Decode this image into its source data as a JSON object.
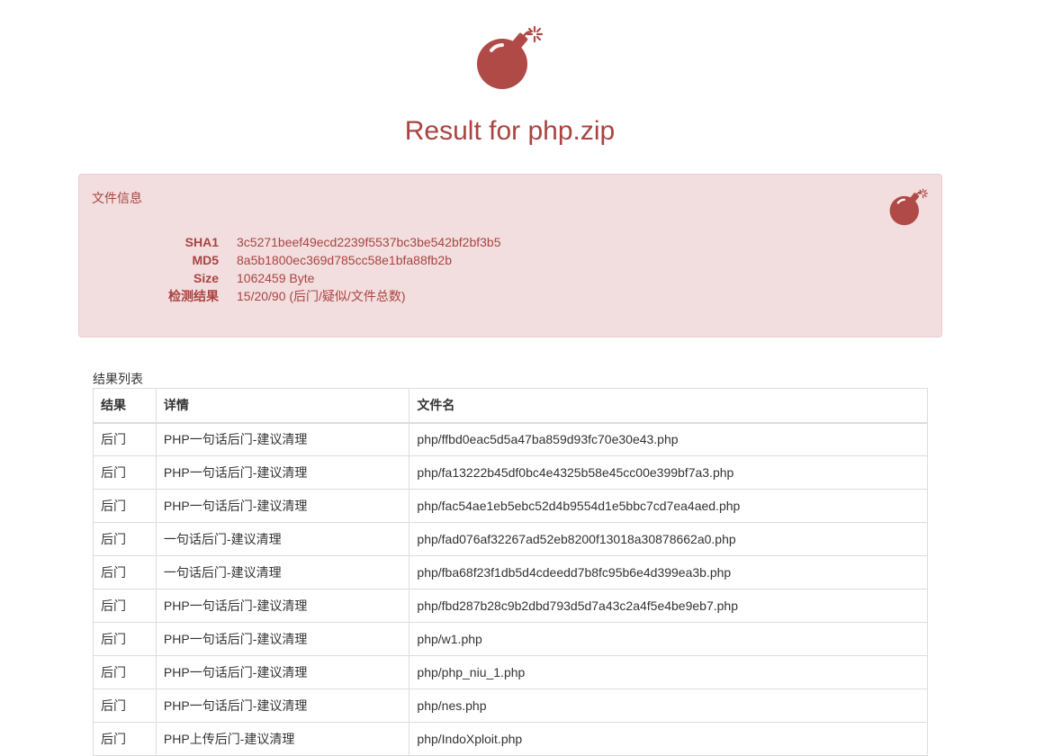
{
  "header": {
    "title": "Result for php.zip"
  },
  "file_info": {
    "heading": "文件信息",
    "rows": [
      {
        "key": "SHA1",
        "value": "3c5271beef49ecd2239f5537bc3be542bf2bf3b5"
      },
      {
        "key": "MD5",
        "value": "8a5b1800ec369d785cc58e1bfa88fb2b"
      },
      {
        "key": "Size",
        "value": "1062459 Byte"
      },
      {
        "key": "检测结果",
        "value": "15/20/90 (后门/疑似/文件总数)"
      }
    ]
  },
  "results": {
    "caption": "结果列表",
    "columns": [
      "结果",
      "详情",
      "文件名"
    ],
    "rows": [
      [
        "后门",
        "PHP一句话后门-建议清理",
        "php/ffbd0eac5d5a47ba859d93fc70e30e43.php"
      ],
      [
        "后门",
        "PHP一句话后门-建议清理",
        "php/fa13222b45df0bc4e4325b58e45cc00e399bf7a3.php"
      ],
      [
        "后门",
        "PHP一句话后门-建议清理",
        "php/fac54ae1eb5ebc52d4b9554d1e5bbc7cd7ea4aed.php"
      ],
      [
        "后门",
        "一句话后门-建议清理",
        "php/fad076af32267ad52eb8200f13018a30878662a0.php"
      ],
      [
        "后门",
        "一句话后门-建议清理",
        "php/fba68f23f1db5d4cdeedd7b8fc95b6e4d399ea3b.php"
      ],
      [
        "后门",
        "PHP一句话后门-建议清理",
        "php/fbd287b28c9b2dbd793d5d7a43c2a4f5e4be9eb7.php"
      ],
      [
        "后门",
        "PHP一句话后门-建议清理",
        "php/w1.php"
      ],
      [
        "后门",
        "PHP一句话后门-建议清理",
        "php/php_niu_1.php"
      ],
      [
        "后门",
        "PHP一句话后门-建议清理",
        "php/nes.php"
      ],
      [
        "后门",
        "PHP上传后门-建议清理",
        "php/IndoXploit.php"
      ]
    ]
  },
  "colors": {
    "danger_text": "#a94442",
    "danger_bg": "#f2dede",
    "bomb": "#b04a47"
  },
  "icons": [
    "bomb-icon"
  ]
}
